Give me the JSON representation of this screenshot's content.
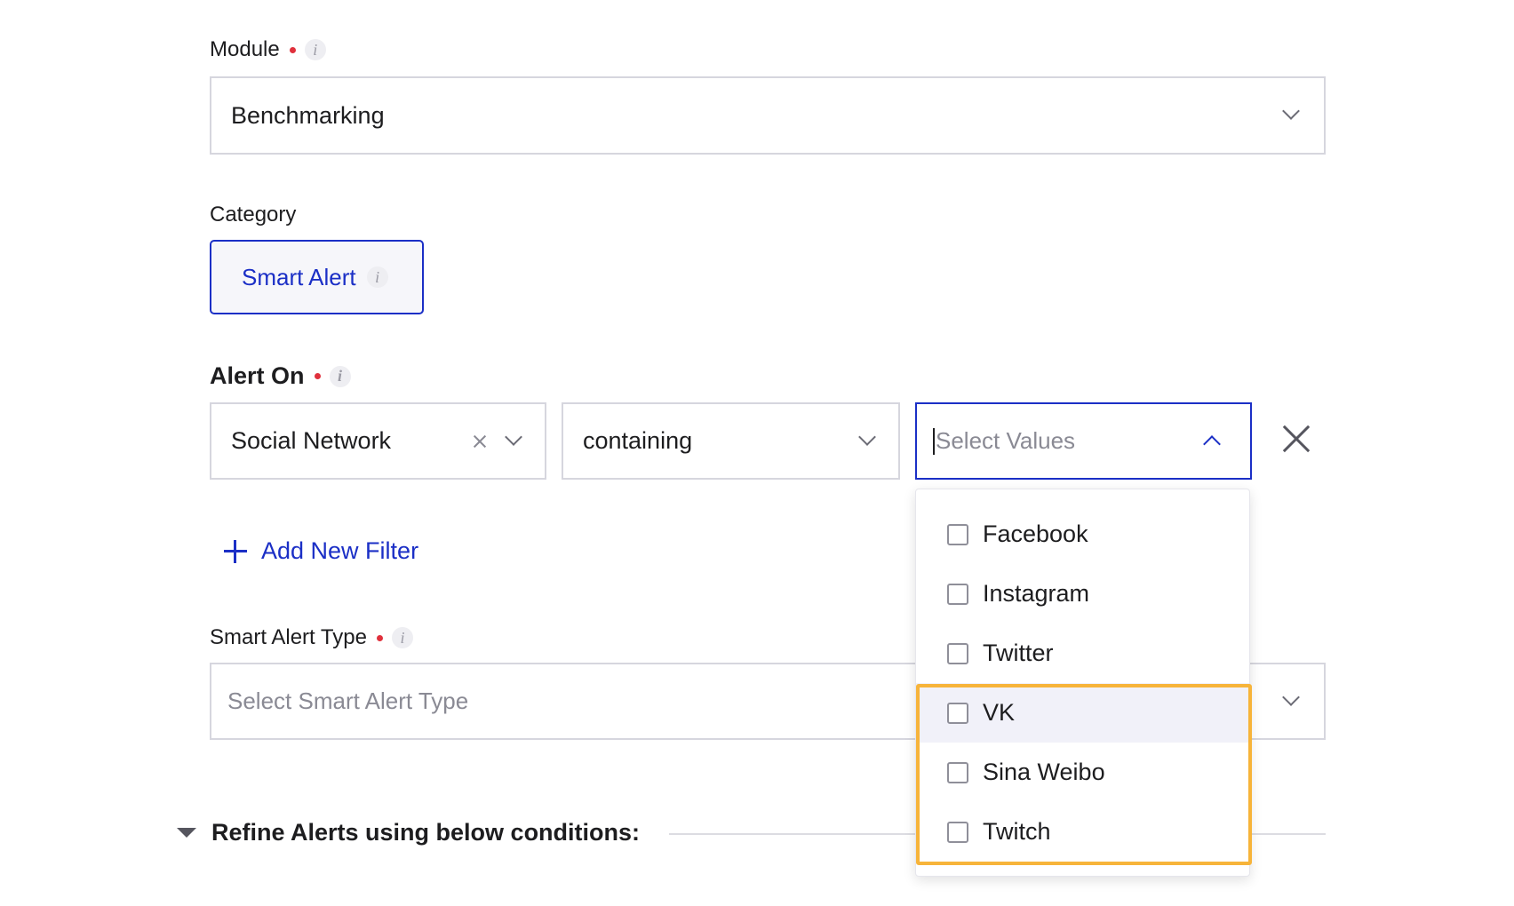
{
  "module": {
    "label": "Module",
    "value": "Benchmarking"
  },
  "category": {
    "label": "Category",
    "chip_label": "Smart Alert"
  },
  "alert_on": {
    "label": "Alert On",
    "field_value": "Social Network",
    "operator_value": "containing",
    "values_placeholder": "Select Values",
    "options": [
      {
        "label": "Facebook",
        "checked": false
      },
      {
        "label": "Instagram",
        "checked": false
      },
      {
        "label": "Twitter",
        "checked": false
      },
      {
        "label": "VK",
        "checked": false
      },
      {
        "label": "Sina Weibo",
        "checked": false
      },
      {
        "label": "Twitch",
        "checked": false
      }
    ],
    "add_filter_label": "Add New Filter"
  },
  "smart_alert_type": {
    "label": "Smart Alert Type",
    "placeholder": "Select Smart Alert Type"
  },
  "refine": {
    "label": "Refine Alerts using below conditions:"
  },
  "colors": {
    "accent": "#1b2fc6",
    "required": "#e0303c",
    "highlight": "#f7b43a"
  }
}
